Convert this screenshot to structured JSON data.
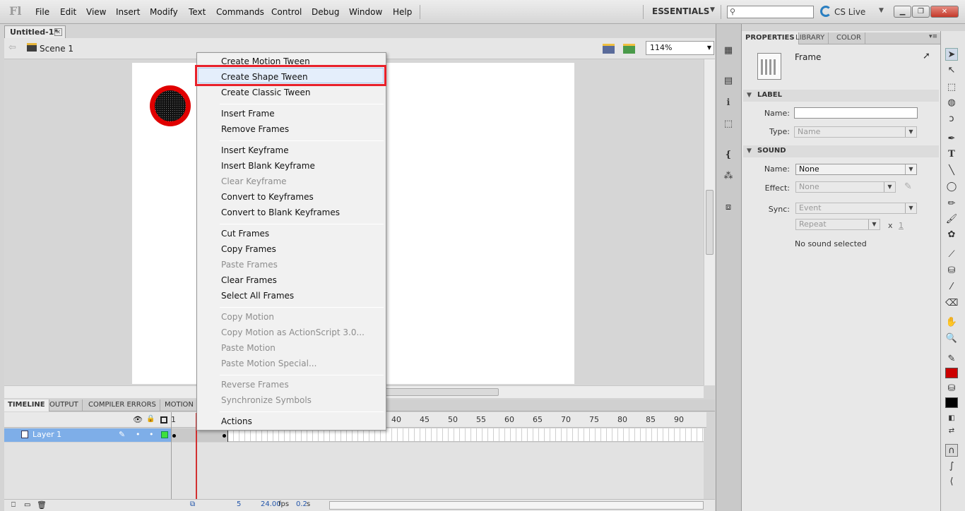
{
  "app": {
    "logo": "Fl"
  },
  "menu": [
    "File",
    "Edit",
    "View",
    "Insert",
    "Modify",
    "Text",
    "Commands",
    "Control",
    "Debug",
    "Window",
    "Help"
  ],
  "workspace": {
    "label": "ESSENTIALS",
    "cs_live": "CS Live"
  },
  "document": {
    "tab": "Untitled-1*",
    "scene": "Scene 1",
    "zoom": "114%"
  },
  "context_menu": {
    "items": [
      {
        "label": "Create Motion Tween",
        "enabled": true
      },
      {
        "label": "Create Shape Tween",
        "enabled": true,
        "highlighted": true
      },
      {
        "label": "Create Classic Tween",
        "enabled": true
      },
      {
        "label": "Insert Frame",
        "enabled": true
      },
      {
        "label": "Remove Frames",
        "enabled": true
      },
      {
        "label": "Insert Keyframe",
        "enabled": true
      },
      {
        "label": "Insert Blank Keyframe",
        "enabled": true
      },
      {
        "label": "Clear Keyframe",
        "enabled": false
      },
      {
        "label": "Convert to Keyframes",
        "enabled": true
      },
      {
        "label": "Convert to Blank Keyframes",
        "enabled": true
      },
      {
        "label": "Cut Frames",
        "enabled": true
      },
      {
        "label": "Copy Frames",
        "enabled": true
      },
      {
        "label": "Paste Frames",
        "enabled": false
      },
      {
        "label": "Clear Frames",
        "enabled": true
      },
      {
        "label": "Select All Frames",
        "enabled": true
      },
      {
        "label": "Copy Motion",
        "enabled": false
      },
      {
        "label": "Copy Motion as ActionScript 3.0...",
        "enabled": false
      },
      {
        "label": "Paste Motion",
        "enabled": false
      },
      {
        "label": "Paste Motion Special...",
        "enabled": false
      },
      {
        "label": "Reverse Frames",
        "enabled": false
      },
      {
        "label": "Synchronize Symbols",
        "enabled": false
      },
      {
        "label": "Actions",
        "enabled": true
      }
    ]
  },
  "timeline": {
    "tabs": [
      "TIMELINE",
      "OUTPUT",
      "COMPILER ERRORS",
      "MOTION"
    ],
    "frame_numbers": [
      "1",
      "40",
      "45",
      "50",
      "55",
      "60",
      "65",
      "70",
      "75",
      "80",
      "85",
      "90"
    ],
    "layer": "Layer 1",
    "current_frame": "5",
    "fps": "24.00",
    "fps_unit": "fps",
    "time": "0.2",
    "time_unit": "s"
  },
  "properties": {
    "tabs": [
      "PROPERTIES",
      "LIBRARY",
      "COLOR"
    ],
    "type": "Frame",
    "label_section": "LABEL",
    "name_label": "Name:",
    "type_label": "Type:",
    "type_value": "Name",
    "sound_section": "SOUND",
    "sound_name_label": "Name:",
    "sound_name_value": "None",
    "effect_label": "Effect:",
    "effect_value": "None",
    "sync_label": "Sync:",
    "sync_value": "Event",
    "repeat_value": "Repeat",
    "repeat_x": "x",
    "repeat_count": "1",
    "no_sound": "No sound selected"
  },
  "colors": {
    "accent_highlight": "#e8202a",
    "stroke_color": "#cc0000",
    "fill_color": "#000000",
    "layer_selected": "#7eaee8"
  }
}
